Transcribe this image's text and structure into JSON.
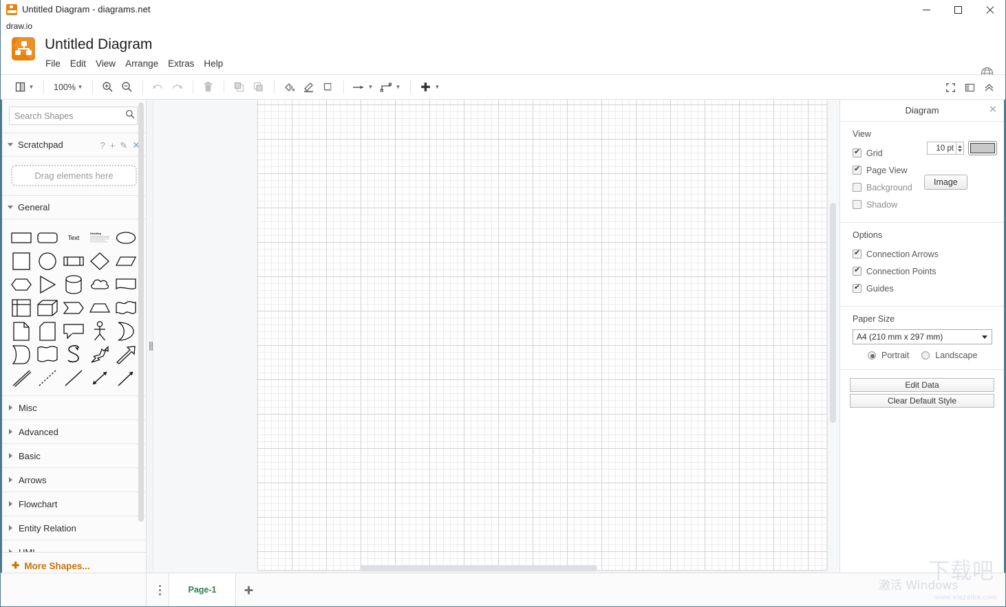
{
  "window": {
    "title": "Untitled Diagram - diagrams.net",
    "app_icon": "drawio-app-icon",
    "minimize_label": "minimize",
    "maximize_label": "maximize",
    "close_label": "close"
  },
  "brand": {
    "label": "draw.io"
  },
  "header": {
    "doc_title": "Untitled Diagram",
    "logo": "drawio-logo",
    "globe_icon": "globe-icon",
    "menus": [
      "File",
      "Edit",
      "View",
      "Arrange",
      "Extras",
      "Help"
    ]
  },
  "toolbar": {
    "view_icon": "view-layout-icon",
    "zoom_value": "100%",
    "zoom_in_icon": "zoom-in-icon",
    "zoom_out_icon": "zoom-out-icon",
    "undo_icon": "undo-icon",
    "redo_icon": "redo-icon",
    "delete_icon": "trash-icon",
    "to_front_icon": "bring-to-front-icon",
    "to_back_icon": "send-to-back-icon",
    "fill_icon": "fill-color-icon",
    "line_icon": "line-color-icon",
    "shadow_icon": "shadow-icon",
    "waypoints_icon": "connection-arrow-icon",
    "connection_icon": "waypoint-style-icon",
    "insert_icon": "insert-plus-icon",
    "right": {
      "fullscreen_icon": "fullscreen-icon",
      "format_panel_icon": "format-panel-icon",
      "collapse_icon": "collapse-chevrons-icon"
    }
  },
  "sidebar": {
    "search": {
      "placeholder": "Search Shapes",
      "value": "",
      "icon": "search-icon"
    },
    "scratchpad": {
      "label": "Scratchpad",
      "dropzone_text": "Drag elements here",
      "actions": [
        {
          "name": "help-icon",
          "glyph": "?"
        },
        {
          "name": "add-icon",
          "glyph": "+"
        },
        {
          "name": "edit-pencil-icon",
          "glyph": "✎"
        },
        {
          "name": "close-icon",
          "glyph": "✕"
        }
      ]
    },
    "general_label": "General",
    "shapes": [
      "rectangle",
      "rounded-rectangle",
      "text",
      "textbox-heading",
      "ellipse",
      "square",
      "circle",
      "process",
      "rhombus",
      "parallelogram",
      "hexagon",
      "triangle",
      "cylinder",
      "cloud",
      "document",
      "internal-storage",
      "cube",
      "step",
      "trapezoid",
      "tape",
      "note",
      "card",
      "callout",
      "actor",
      "or-shape",
      "data-storage",
      "curly-document",
      "curve-arrow",
      "bidirectional-arrow",
      "arrow",
      "double-line",
      "dashed-line",
      "line",
      "bidirectional-connector",
      "directional-connector"
    ],
    "categories": [
      "Misc",
      "Advanced",
      "Basic",
      "Arrows",
      "Flowchart",
      "Entity Relation",
      "UML"
    ],
    "more_shapes": "More Shapes..."
  },
  "format_panel": {
    "title": "Diagram",
    "close_icon": "close-icon",
    "view": {
      "heading": "View",
      "grid": {
        "label": "Grid",
        "checked": true,
        "size_value": "10 pt",
        "color": "#c9c9c9"
      },
      "page_view": {
        "label": "Page View",
        "checked": true
      },
      "background": {
        "label": "Background",
        "checked": false,
        "button": "Image"
      },
      "shadow": {
        "label": "Shadow",
        "checked": false
      }
    },
    "options": {
      "heading": "Options",
      "items": [
        {
          "label": "Connection Arrows",
          "checked": true
        },
        {
          "label": "Connection Points",
          "checked": true
        },
        {
          "label": "Guides",
          "checked": true
        }
      ]
    },
    "paper": {
      "heading": "Paper Size",
      "selected": "A4 (210 mm x 297 mm)",
      "orientation": [
        {
          "label": "Portrait",
          "selected": true
        },
        {
          "label": "Landscape",
          "selected": false
        }
      ]
    },
    "buttons": [
      "Edit Data",
      "Clear Default Style"
    ]
  },
  "bottom": {
    "menu_icon": "page-menu-icon",
    "page_tab": "Page-1",
    "add_page_icon": "add-page-icon"
  },
  "watermark": {
    "activate": "激活 Windows",
    "zh": "下载吧",
    "url": "www.xiazaiba.com"
  },
  "colors": {
    "accent_orange": "#e8820c",
    "more_shapes_orange": "#c9730a",
    "page_tab_green": "#2e7d4f",
    "window_border": "#4a7a8c"
  }
}
